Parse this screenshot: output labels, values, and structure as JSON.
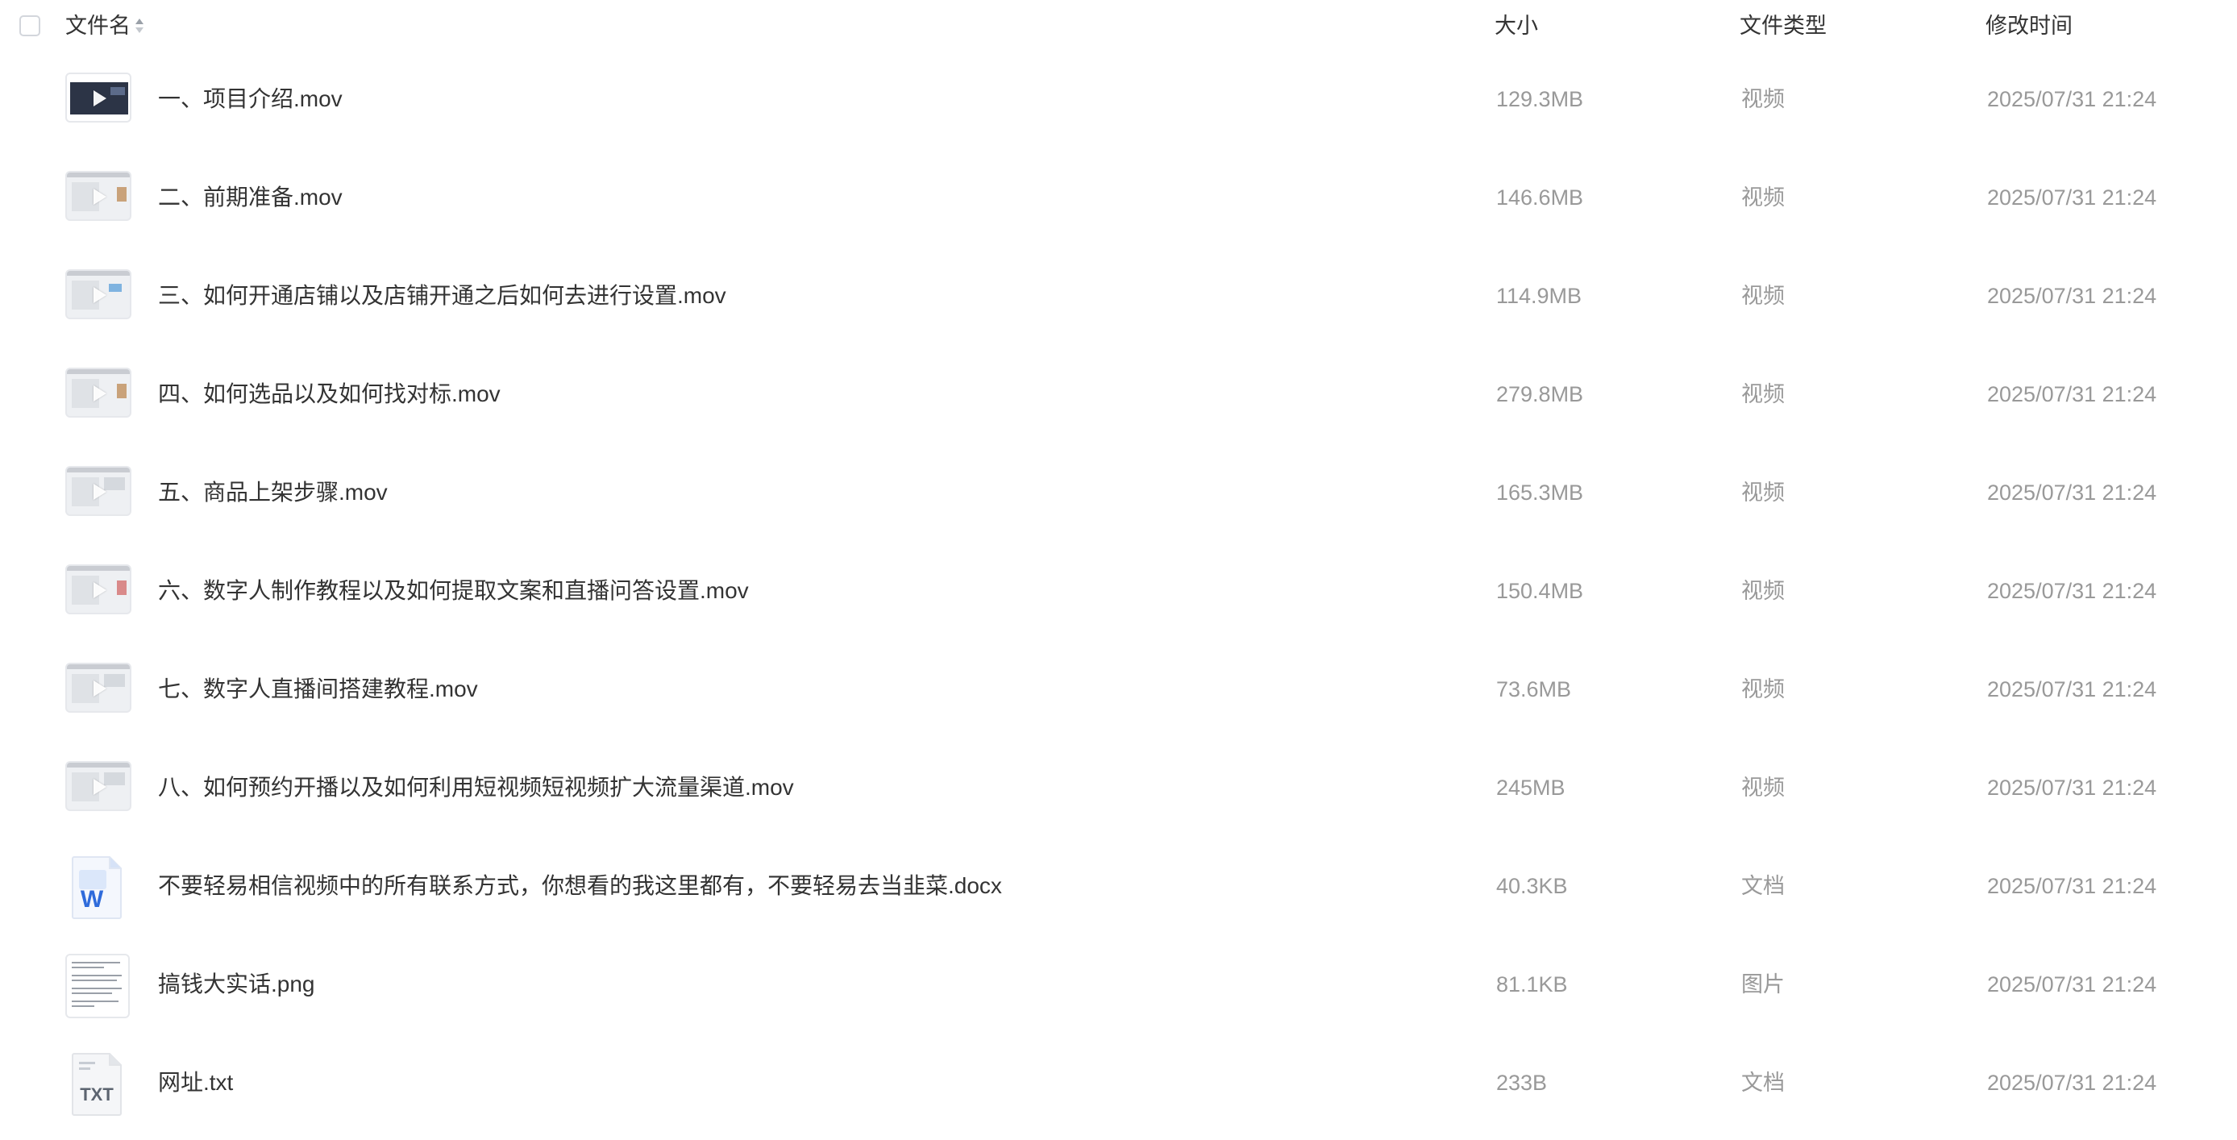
{
  "header": {
    "name": "文件名",
    "size": "大小",
    "type": "文件类型",
    "modified": "修改时间"
  },
  "files": [
    {
      "name": "一、项目介绍.mov",
      "size": "129.3MB",
      "type": "视频",
      "modified": "2025/07/31 21:24",
      "icon": "video-thumbnail"
    },
    {
      "name": "二、前期准备.mov",
      "size": "146.6MB",
      "type": "视频",
      "modified": "2025/07/31 21:24",
      "icon": "video-thumbnail"
    },
    {
      "name": "三、如何开通店铺以及店铺开通之后如何去进行设置.mov",
      "size": "114.9MB",
      "type": "视频",
      "modified": "2025/07/31 21:24",
      "icon": "video-thumbnail"
    },
    {
      "name": "四、如何选品以及如何找对标.mov",
      "size": "279.8MB",
      "type": "视频",
      "modified": "2025/07/31 21:24",
      "icon": "video-thumbnail"
    },
    {
      "name": "五、商品上架步骤.mov",
      "size": "165.3MB",
      "type": "视频",
      "modified": "2025/07/31 21:24",
      "icon": "video-thumbnail"
    },
    {
      "name": "六、数字人制作教程以及如何提取文案和直播问答设置.mov",
      "size": "150.4MB",
      "type": "视频",
      "modified": "2025/07/31 21:24",
      "icon": "video-thumbnail"
    },
    {
      "name": "七、数字人直播间搭建教程.mov",
      "size": "73.6MB",
      "type": "视频",
      "modified": "2025/07/31 21:24",
      "icon": "video-thumbnail"
    },
    {
      "name": "八、如何预约开播以及如何利用短视频短视频扩大流量渠道.mov",
      "size": "245MB",
      "type": "视频",
      "modified": "2025/07/31 21:24",
      "icon": "video-thumbnail"
    },
    {
      "name": "不要轻易相信视频中的所有联系方式，你想看的我这里都有，不要轻易去当韭菜.docx",
      "size": "40.3KB",
      "type": "文档",
      "modified": "2025/07/31 21:24",
      "icon": "word-doc-icon",
      "icon_letter": "W"
    },
    {
      "name": "搞钱大实话.png",
      "size": "81.1KB",
      "type": "图片",
      "modified": "2025/07/31 21:24",
      "icon": "image-thumbnail"
    },
    {
      "name": "网址.txt",
      "size": "233B",
      "type": "文档",
      "modified": "2025/07/31 21:24",
      "icon": "txt-file-icon",
      "icon_letter": "TXT"
    }
  ]
}
